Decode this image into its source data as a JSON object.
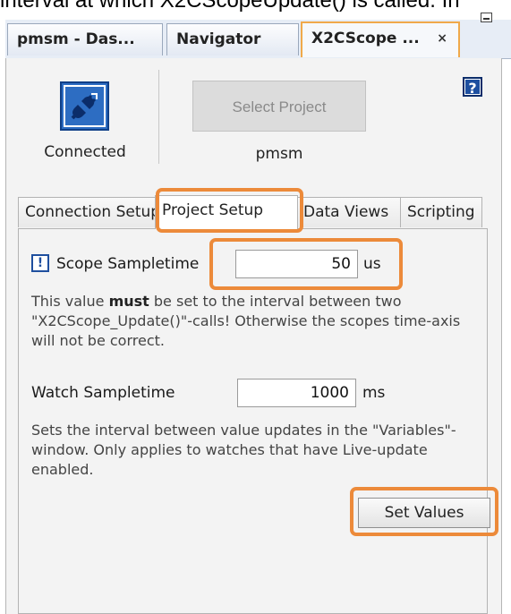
{
  "caption_text": "interval at which X2CScopeUpdate() is called. In",
  "window_tabs": [
    {
      "label": "pmsm - Das..."
    },
    {
      "label": "Navigator"
    },
    {
      "label": "X2CScope ...",
      "close": "×"
    }
  ],
  "help_icon": {
    "glyph": "?"
  },
  "status": {
    "connection_label": "Connected",
    "select_project_label": "Select Project",
    "project_name": "pmsm"
  },
  "inner_tabs": [
    {
      "label": "Connection Setup"
    },
    {
      "label": "Project Setup"
    },
    {
      "label": "Data Views"
    },
    {
      "label": "Scripting"
    }
  ],
  "scope": {
    "warn_glyph": "!",
    "label": "Scope Sampletime",
    "value": "50",
    "unit": "us",
    "desc_pre": "This value ",
    "desc_bold": "must",
    "desc_post": " be set to the interval between two \"X2CScope_Update()\"-calls! Otherwise the scopes time-axis will not be correct."
  },
  "watch": {
    "label": "Watch Sampletime",
    "value": "1000",
    "unit": "ms",
    "desc": "Sets the interval between value updates in the \"Variables\"-window. Only applies to watches that have Live-update enabled."
  },
  "set_values_label": "Set Values",
  "colors": {
    "highlight": "#ec8a3a",
    "icon_blue": "#1d4fa0"
  }
}
